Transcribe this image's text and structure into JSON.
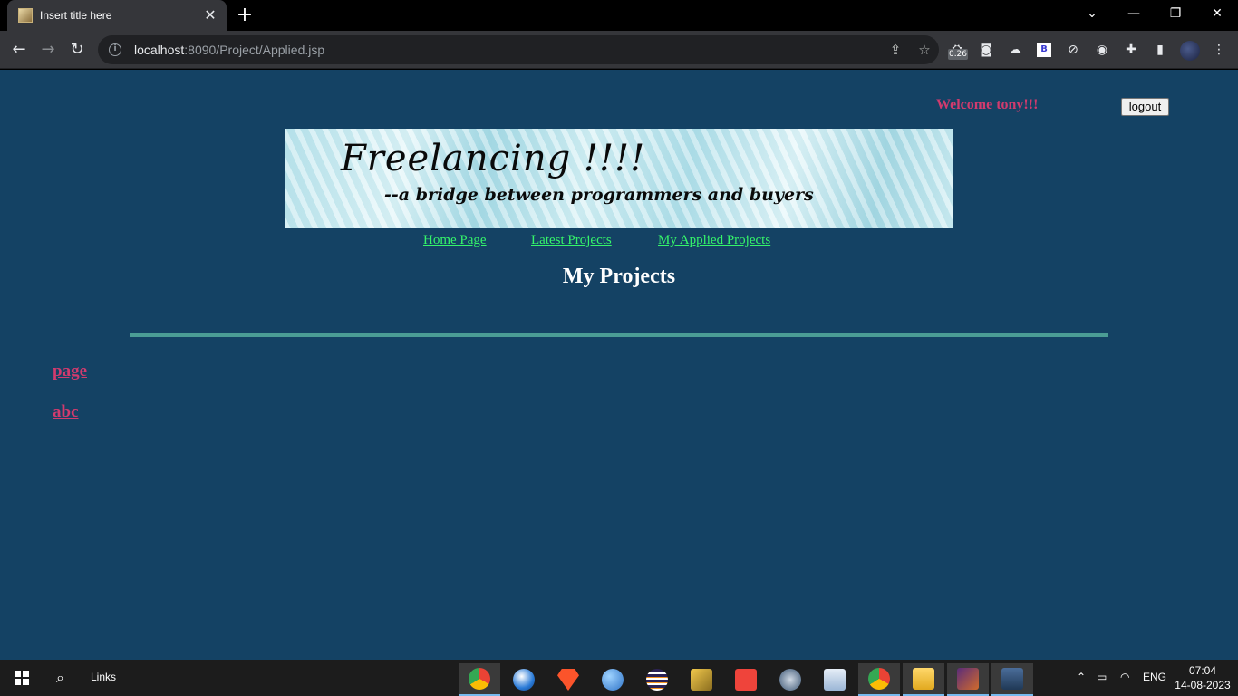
{
  "browser": {
    "tab_title": "Insert title here",
    "url_host": "localhost",
    "url_rest": ":8090/Project/Applied.jsp",
    "extension_counter": "0.26",
    "extension_b": "B"
  },
  "page": {
    "welcome": "Welcome tony!!!",
    "logout_label": "logout",
    "banner_title": "Freelancing !!!!",
    "banner_subtitle": "--a bridge between programmers and buyers",
    "nav": {
      "home": "Home Page",
      "latest": "Latest Projects",
      "applied": "My Applied Projects"
    },
    "heading": "My Projects",
    "projects": [
      "page",
      "abc"
    ],
    "colors": {
      "background": "#144264",
      "accent_pink": "#d13b6e",
      "nav_green": "#35f56a",
      "divider": "#4b9d95"
    }
  },
  "taskbar": {
    "search_label": "Links",
    "language": "ENG",
    "time": "07:04",
    "date": "14-08-2023"
  }
}
